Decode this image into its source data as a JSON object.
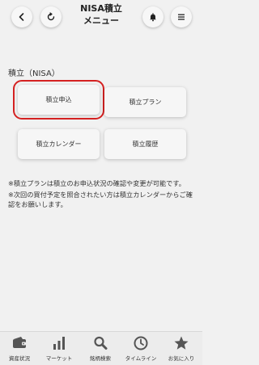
{
  "header": {
    "title_line1": "NISA積立",
    "title_line2": "メニュー",
    "back_icon": "chevron-left",
    "reload_icon": "reload",
    "bell_icon": "bell",
    "menu_icon": "hamburger"
  },
  "section": {
    "title": "積立（NISA）",
    "cards": [
      {
        "label": "積立申込"
      },
      {
        "label": "積立プラン"
      },
      {
        "label": "積立カレンダー"
      },
      {
        "label": "積立履歴"
      }
    ]
  },
  "notes": [
    "※積立プランは積立のお申込状況の確認や変更が可能です。",
    "※次回の買付予定を照合されたい方は積立カレンダーからご確認をお願いします。"
  ],
  "tabbar": {
    "items": [
      {
        "label": "資産状況",
        "icon": "wallet-icon"
      },
      {
        "label": "マーケット",
        "icon": "bar-chart-icon"
      },
      {
        "label": "銘柄検索",
        "icon": "search-icon"
      },
      {
        "label": "タイムライン",
        "icon": "clock-icon"
      },
      {
        "label": "お気に入り",
        "icon": "star-icon"
      }
    ]
  },
  "colors": {
    "highlight": "#d42121",
    "background": "#f1f1f1",
    "icon": "#555555"
  }
}
